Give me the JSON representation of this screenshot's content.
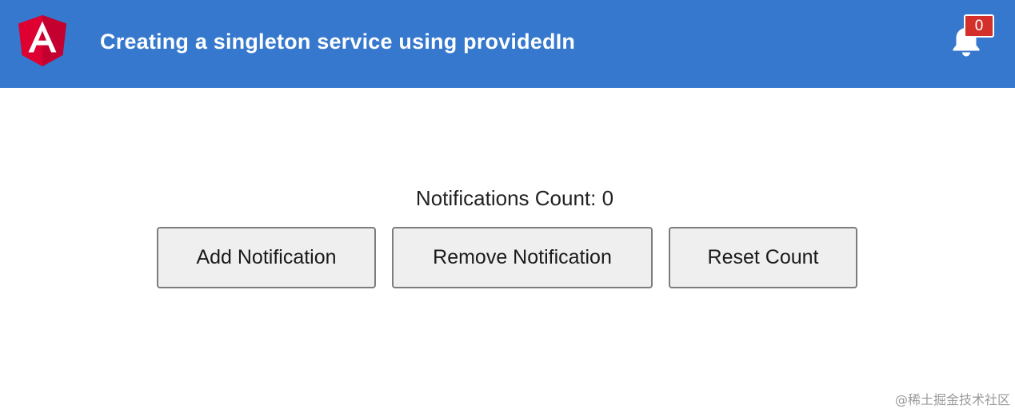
{
  "header": {
    "title": "Creating a singleton service using providedIn",
    "logo_icon": "angular-logo-icon",
    "bell_icon": "bell-icon",
    "badge_count": "0",
    "colors": {
      "bar": "#3578cd",
      "logo_red": "#dd0031",
      "badge": "#d4302b"
    }
  },
  "main": {
    "count_text": "Notifications Count: 0",
    "buttons": {
      "add": "Add Notification",
      "remove": "Remove Notification",
      "reset": "Reset Count"
    }
  },
  "watermark": "@稀土掘金技术社区"
}
